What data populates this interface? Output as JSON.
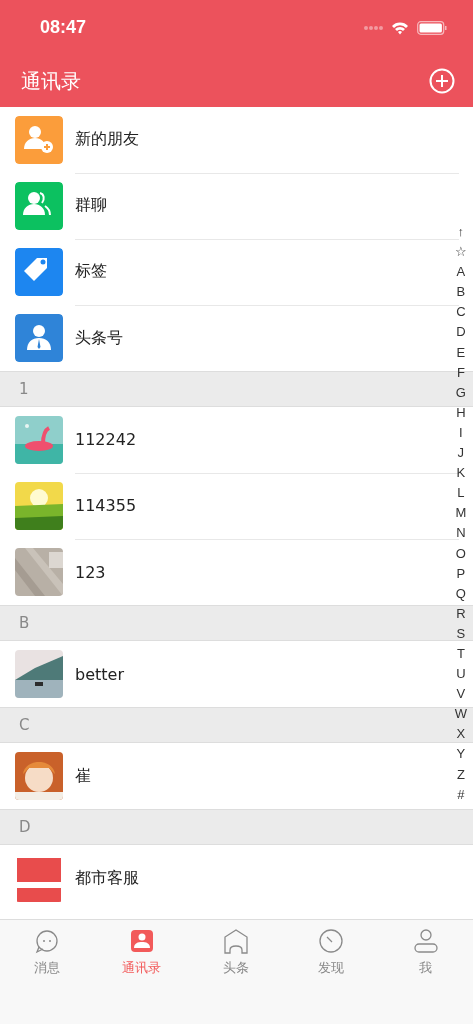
{
  "status_bar": {
    "time": "08:47"
  },
  "nav": {
    "title": "通讯录"
  },
  "functions": [
    {
      "label": "新的朋友"
    },
    {
      "label": "群聊"
    },
    {
      "label": "标签"
    },
    {
      "label": "头条号"
    }
  ],
  "sections": [
    {
      "header": "1",
      "contacts": [
        {
          "name": "112242"
        },
        {
          "name": "114355"
        },
        {
          "name": "123"
        }
      ]
    },
    {
      "header": "B",
      "contacts": [
        {
          "name": "better"
        }
      ]
    },
    {
      "header": "C",
      "contacts": [
        {
          "name": "崔"
        }
      ]
    },
    {
      "header": "D",
      "contacts": [
        {
          "name": "都市客服"
        }
      ]
    }
  ],
  "index_bar": [
    "↑",
    "☆",
    "A",
    "B",
    "C",
    "D",
    "E",
    "F",
    "G",
    "H",
    "I",
    "J",
    "K",
    "L",
    "M",
    "N",
    "O",
    "P",
    "Q",
    "R",
    "S",
    "T",
    "U",
    "V",
    "W",
    "X",
    "Y",
    "Z",
    "#"
  ],
  "tabs": [
    {
      "label": "消息",
      "selected": false
    },
    {
      "label": "通讯录",
      "selected": true
    },
    {
      "label": "头条",
      "selected": false
    },
    {
      "label": "发现",
      "selected": false
    },
    {
      "label": "我",
      "selected": false
    }
  ]
}
